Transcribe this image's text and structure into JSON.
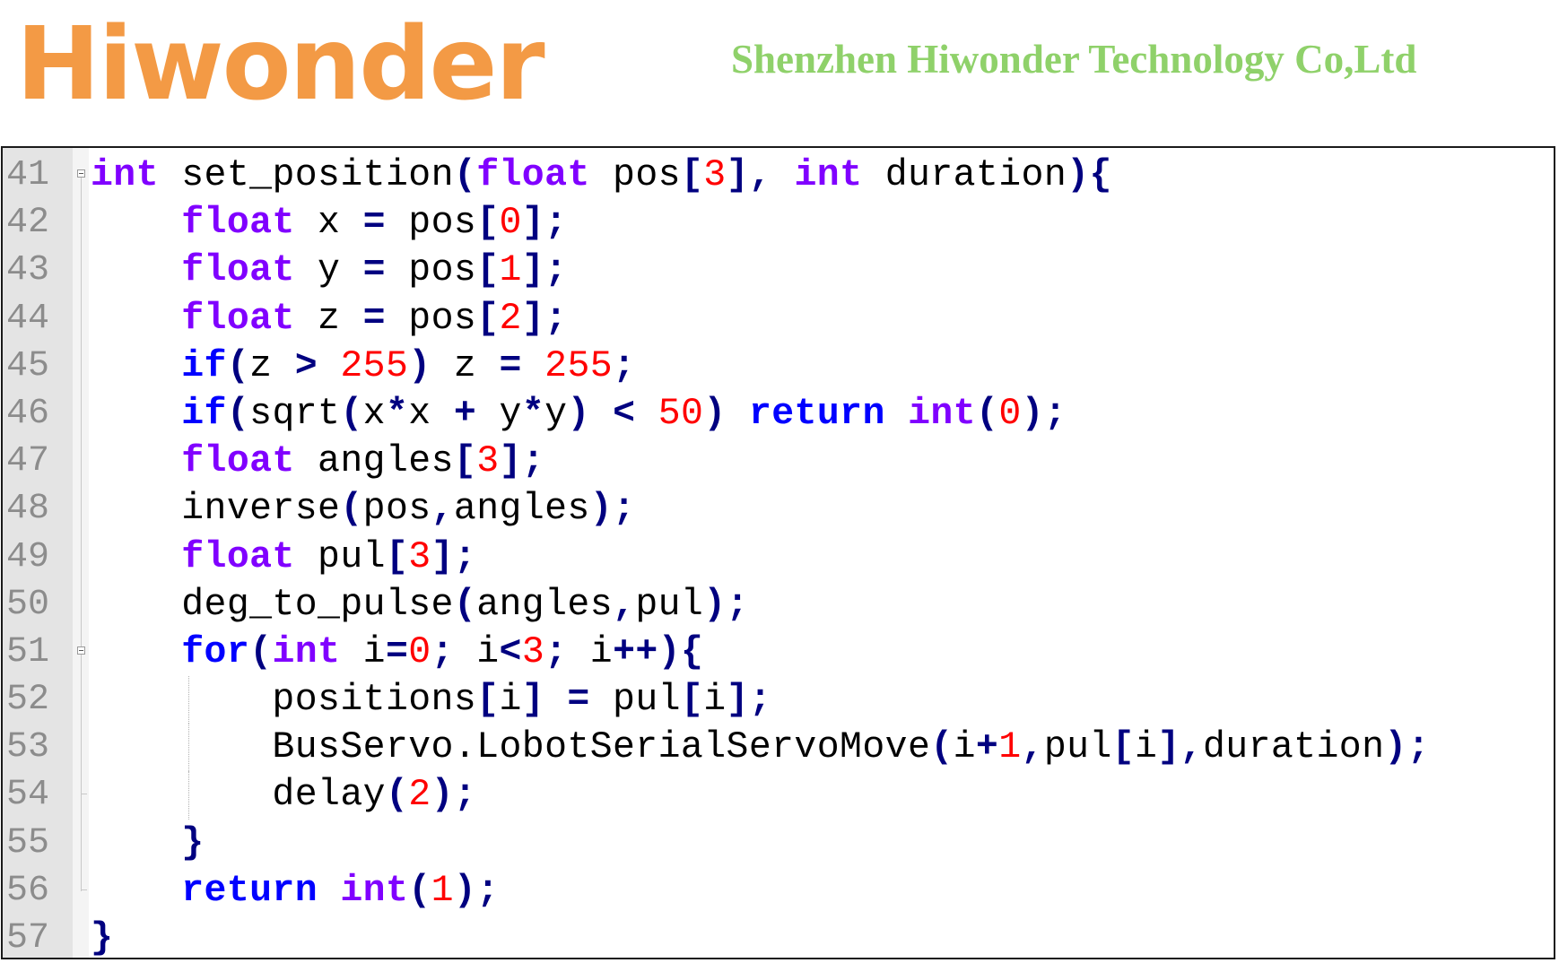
{
  "header": {
    "logo_text": "Hiwonder",
    "company_name": "Shenzhen Hiwonder Technology Co,Ltd"
  },
  "colors": {
    "logo": "#f39a45",
    "company": "#8fd16a",
    "keyword": "#0000ff",
    "type": "#8000ff",
    "number": "#ff0000",
    "operator": "#000080",
    "line_number": "#8c8c8c"
  },
  "editor": {
    "lines": [
      {
        "number": "41",
        "fold": "open",
        "tokens": [
          [
            "type",
            "int"
          ],
          [
            "ident",
            " set_position"
          ],
          [
            "operator",
            "("
          ],
          [
            "type",
            "float"
          ],
          [
            "ident",
            " pos"
          ],
          [
            "operator",
            "["
          ],
          [
            "number",
            "3"
          ],
          [
            "operator",
            "],"
          ],
          [
            "ident",
            " "
          ],
          [
            "type",
            "int"
          ],
          [
            "ident",
            " duration"
          ],
          [
            "operator",
            "){"
          ]
        ]
      },
      {
        "number": "42",
        "fold": "line",
        "tokens": [
          [
            "ident",
            "    "
          ],
          [
            "type",
            "float"
          ],
          [
            "ident",
            " x "
          ],
          [
            "operator",
            "="
          ],
          [
            "ident",
            " pos"
          ],
          [
            "operator",
            "["
          ],
          [
            "number",
            "0"
          ],
          [
            "operator",
            "];"
          ]
        ]
      },
      {
        "number": "43",
        "fold": "line",
        "tokens": [
          [
            "ident",
            "    "
          ],
          [
            "type",
            "float"
          ],
          [
            "ident",
            " y "
          ],
          [
            "operator",
            "="
          ],
          [
            "ident",
            " pos"
          ],
          [
            "operator",
            "["
          ],
          [
            "number",
            "1"
          ],
          [
            "operator",
            "];"
          ]
        ]
      },
      {
        "number": "44",
        "fold": "line",
        "tokens": [
          [
            "ident",
            "    "
          ],
          [
            "type",
            "float"
          ],
          [
            "ident",
            " z "
          ],
          [
            "operator",
            "="
          ],
          [
            "ident",
            " pos"
          ],
          [
            "operator",
            "["
          ],
          [
            "number",
            "2"
          ],
          [
            "operator",
            "];"
          ]
        ]
      },
      {
        "number": "45",
        "fold": "line",
        "tokens": [
          [
            "ident",
            "    "
          ],
          [
            "keyword",
            "if"
          ],
          [
            "operator",
            "("
          ],
          [
            "ident",
            "z "
          ],
          [
            "operator",
            ">"
          ],
          [
            "ident",
            " "
          ],
          [
            "number",
            "255"
          ],
          [
            "operator",
            ")"
          ],
          [
            "ident",
            " z "
          ],
          [
            "operator",
            "="
          ],
          [
            "ident",
            " "
          ],
          [
            "number",
            "255"
          ],
          [
            "operator",
            ";"
          ]
        ]
      },
      {
        "number": "46",
        "fold": "line",
        "tokens": [
          [
            "ident",
            "    "
          ],
          [
            "keyword",
            "if"
          ],
          [
            "operator",
            "("
          ],
          [
            "ident",
            "sqrt"
          ],
          [
            "operator",
            "("
          ],
          [
            "ident",
            "x"
          ],
          [
            "operator",
            "*"
          ],
          [
            "ident",
            "x "
          ],
          [
            "operator",
            "+"
          ],
          [
            "ident",
            " y"
          ],
          [
            "operator",
            "*"
          ],
          [
            "ident",
            "y"
          ],
          [
            "operator",
            ")"
          ],
          [
            "ident",
            " "
          ],
          [
            "operator",
            "<"
          ],
          [
            "ident",
            " "
          ],
          [
            "number",
            "50"
          ],
          [
            "operator",
            ")"
          ],
          [
            "ident",
            " "
          ],
          [
            "keyword",
            "return"
          ],
          [
            "ident",
            " "
          ],
          [
            "type",
            "int"
          ],
          [
            "operator",
            "("
          ],
          [
            "number",
            "0"
          ],
          [
            "operator",
            ");"
          ]
        ]
      },
      {
        "number": "47",
        "fold": "line",
        "tokens": [
          [
            "ident",
            "    "
          ],
          [
            "type",
            "float"
          ],
          [
            "ident",
            " angles"
          ],
          [
            "operator",
            "["
          ],
          [
            "number",
            "3"
          ],
          [
            "operator",
            "];"
          ]
        ]
      },
      {
        "number": "48",
        "fold": "line",
        "tokens": [
          [
            "ident",
            "    inverse"
          ],
          [
            "operator",
            "("
          ],
          [
            "ident",
            "pos"
          ],
          [
            "operator",
            ","
          ],
          [
            "ident",
            "angles"
          ],
          [
            "operator",
            ");"
          ]
        ]
      },
      {
        "number": "49",
        "fold": "line",
        "tokens": [
          [
            "ident",
            "    "
          ],
          [
            "type",
            "float"
          ],
          [
            "ident",
            " pul"
          ],
          [
            "operator",
            "["
          ],
          [
            "number",
            "3"
          ],
          [
            "operator",
            "];"
          ]
        ]
      },
      {
        "number": "50",
        "fold": "line",
        "tokens": [
          [
            "ident",
            "    deg_to_pulse"
          ],
          [
            "operator",
            "("
          ],
          [
            "ident",
            "angles"
          ],
          [
            "operator",
            ","
          ],
          [
            "ident",
            "pul"
          ],
          [
            "operator",
            ");"
          ]
        ]
      },
      {
        "number": "51",
        "fold": "open",
        "tokens": [
          [
            "ident",
            "    "
          ],
          [
            "keyword",
            "for"
          ],
          [
            "operator",
            "("
          ],
          [
            "type",
            "int"
          ],
          [
            "ident",
            " i"
          ],
          [
            "operator",
            "="
          ],
          [
            "number",
            "0"
          ],
          [
            "operator",
            ";"
          ],
          [
            "ident",
            " i"
          ],
          [
            "operator",
            "<"
          ],
          [
            "number",
            "3"
          ],
          [
            "operator",
            ";"
          ],
          [
            "ident",
            " i"
          ],
          [
            "operator",
            "++){"
          ]
        ]
      },
      {
        "number": "52",
        "fold": "line",
        "guide": true,
        "tokens": [
          [
            "ident",
            "        positions"
          ],
          [
            "operator",
            "["
          ],
          [
            "ident",
            "i"
          ],
          [
            "operator",
            "]"
          ],
          [
            "ident",
            " "
          ],
          [
            "operator",
            "="
          ],
          [
            "ident",
            " pul"
          ],
          [
            "operator",
            "["
          ],
          [
            "ident",
            "i"
          ],
          [
            "operator",
            "];"
          ]
        ]
      },
      {
        "number": "53",
        "fold": "line",
        "guide": true,
        "tokens": [
          [
            "ident",
            "        BusServo.LobotSerialServoMove"
          ],
          [
            "operator",
            "("
          ],
          [
            "ident",
            "i"
          ],
          [
            "operator",
            "+"
          ],
          [
            "number",
            "1"
          ],
          [
            "operator",
            ","
          ],
          [
            "ident",
            "pul"
          ],
          [
            "operator",
            "["
          ],
          [
            "ident",
            "i"
          ],
          [
            "operator",
            "],"
          ],
          [
            "ident",
            "duration"
          ],
          [
            "operator",
            ");"
          ]
        ]
      },
      {
        "number": "54",
        "fold": "tick",
        "guide": true,
        "tokens": [
          [
            "ident",
            "        delay"
          ],
          [
            "operator",
            "("
          ],
          [
            "number",
            "2"
          ],
          [
            "operator",
            ");"
          ]
        ]
      },
      {
        "number": "55",
        "fold": "line",
        "tokens": [
          [
            "ident",
            "    "
          ],
          [
            "operator",
            "}"
          ]
        ]
      },
      {
        "number": "56",
        "fold": "end",
        "tokens": [
          [
            "ident",
            "    "
          ],
          [
            "keyword",
            "return"
          ],
          [
            "ident",
            " "
          ],
          [
            "type",
            "int"
          ],
          [
            "operator",
            "("
          ],
          [
            "number",
            "1"
          ],
          [
            "operator",
            ");"
          ]
        ]
      },
      {
        "number": "57",
        "fold": "none",
        "tokens": [
          [
            "operator",
            "}"
          ]
        ]
      }
    ]
  }
}
